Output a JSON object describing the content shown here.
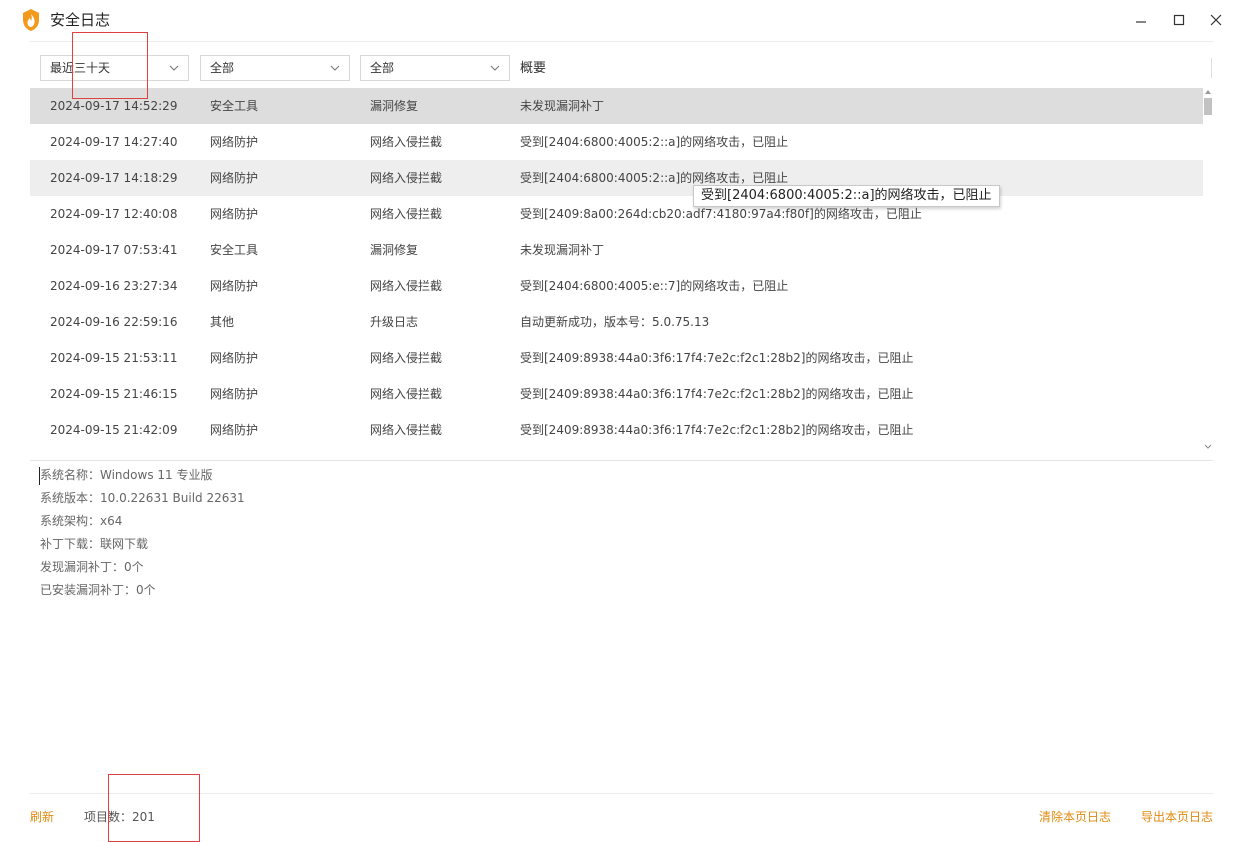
{
  "window": {
    "title": "安全日志",
    "logo_icon": "flame-shield-icon",
    "controls": [
      "minimize-icon",
      "maximize-icon",
      "close-icon"
    ]
  },
  "filters": {
    "time_range": "最近三十天",
    "category": "全部",
    "type": "全部",
    "summary_header": "概要"
  },
  "rows": [
    {
      "time": "2024-09-17 14:52:29",
      "category": "安全工具",
      "type": "漏洞修复",
      "summary": "未发现漏洞补丁"
    },
    {
      "time": "2024-09-17 14:27:40",
      "category": "网络防护",
      "type": "网络入侵拦截",
      "summary": "受到[2404:6800:4005:2::a]的网络攻击，已阻止"
    },
    {
      "time": "2024-09-17 14:18:29",
      "category": "网络防护",
      "type": "网络入侵拦截",
      "summary": "受到[2404:6800:4005:2::a]的网络攻击，已阻止"
    },
    {
      "time": "2024-09-17 12:40:08",
      "category": "网络防护",
      "type": "网络入侵拦截",
      "summary": "受到[2409:8a00:264d:cb20:adf7:4180:97a4:f80f]的网络攻击，已阻止"
    },
    {
      "time": "2024-09-17 07:53:41",
      "category": "安全工具",
      "type": "漏洞修复",
      "summary": "未发现漏洞补丁"
    },
    {
      "time": "2024-09-16 23:27:34",
      "category": "网络防护",
      "type": "网络入侵拦截",
      "summary": "受到[2404:6800:4005:e::7]的网络攻击，已阻止"
    },
    {
      "time": "2024-09-16 22:59:16",
      "category": "其他",
      "type": "升级日志",
      "summary": "自动更新成功，版本号：5.0.75.13"
    },
    {
      "time": "2024-09-15 21:53:11",
      "category": "网络防护",
      "type": "网络入侵拦截",
      "summary": "受到[2409:8938:44a0:3f6:17f4:7e2c:f2c1:28b2]的网络攻击，已阻止"
    },
    {
      "time": "2024-09-15 21:46:15",
      "category": "网络防护",
      "type": "网络入侵拦截",
      "summary": "受到[2409:8938:44a0:3f6:17f4:7e2c:f2c1:28b2]的网络攻击，已阻止"
    },
    {
      "time": "2024-09-15 21:42:09",
      "category": "网络防护",
      "type": "网络入侵拦截",
      "summary": "受到[2409:8938:44a0:3f6:17f4:7e2c:f2c1:28b2]的网络攻击，已阻止"
    }
  ],
  "tooltip": "受到[2404:6800:4005:2::a]的网络攻击，已阻止",
  "detail": [
    "系统名称：Windows 11 专业版",
    "系统版本：10.0.22631 Build 22631",
    "系统架构：x64",
    "补丁下载：联网下载",
    "发现漏洞补丁：0个",
    "已安装漏洞补丁：0个"
  ],
  "footer": {
    "refresh": "刷新",
    "item_count": "项目数：201",
    "clear_page": "清除本页日志",
    "export_page": "导出本页日志"
  },
  "colors": {
    "accent": "#e08a10",
    "selected_row": "#dddddd",
    "hover_row": "#eeeeee"
  }
}
